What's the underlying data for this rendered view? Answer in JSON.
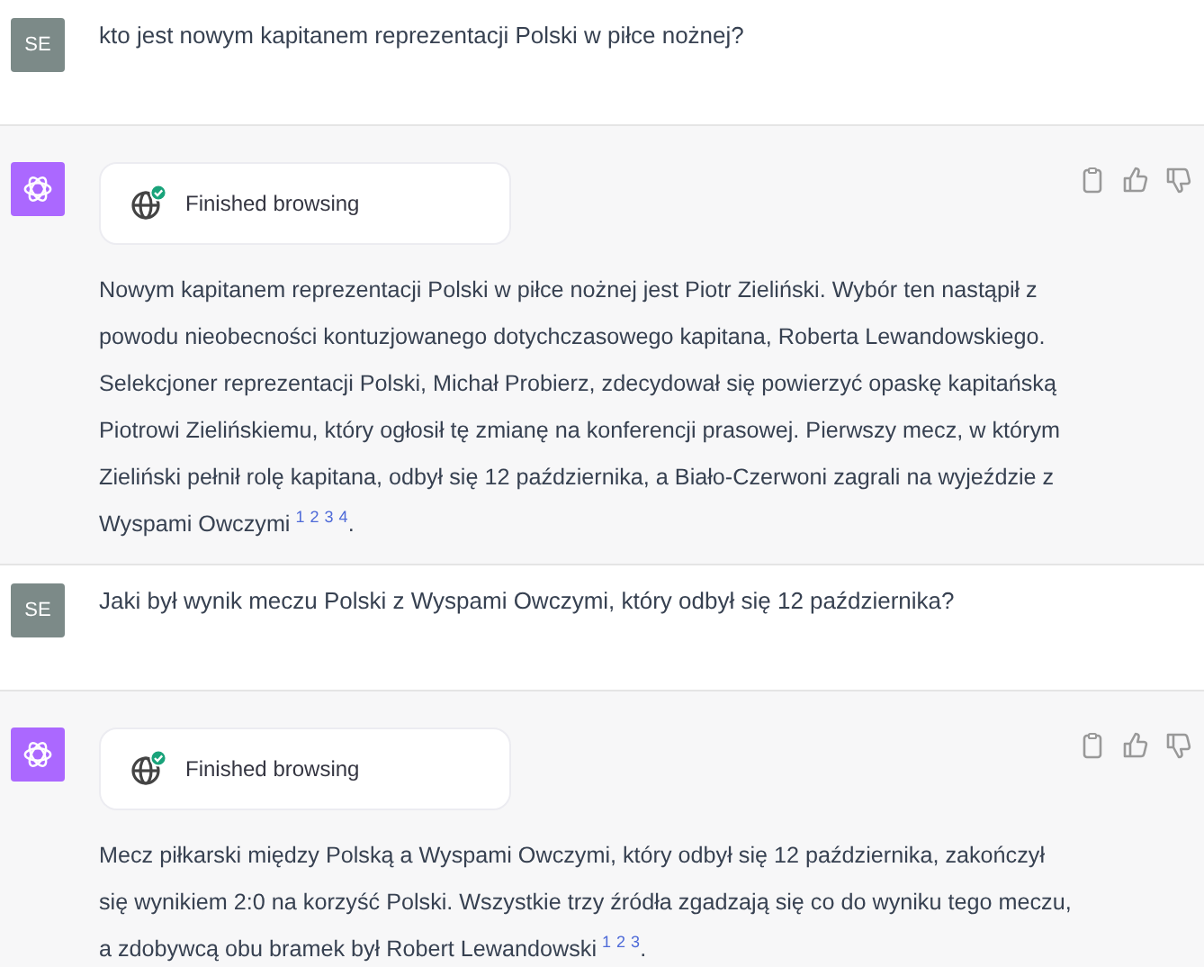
{
  "messages": [
    {
      "kind": "user",
      "avatar": "SE",
      "text": "kto jest nowym kapitanem reprezentacji Polski w piłce nożnej?"
    },
    {
      "kind": "assistant",
      "status": "Finished browsing",
      "text": "Nowym kapitanem reprezentacji Polski w piłce nożnej jest Piotr Zieliński. Wybór ten nastąpił z powodu nieobecności kontuzjowanego dotychczasowego kapitana, Roberta Lewandowskiego. Selekcjoner reprezentacji Polski, Michał Probierz, zdecydował się powierzyć opaskę kapitańską Piotrowi Zielińskiemu, który ogłosił tę zmianę na konferencji prasowej. Pierwszy mecz, w którym Zieliński pełnił rolę kapitana, odbył się 12 października, a Biało-Czerwoni zagrali na wyjeździe z Wyspami Owczymi",
      "citations": [
        "1",
        "2",
        "3",
        "4"
      ],
      "end": "."
    },
    {
      "kind": "user",
      "avatar": "SE",
      "text": "Jaki był wynik meczu Polski z Wyspami Owczymi, który odbył się 12 października?"
    },
    {
      "kind": "assistant",
      "status": "Finished browsing",
      "text": "Mecz piłkarski między Polską a Wyspami Owczymi, który odbył się 12 października, zakończył się wynikiem 2:0 na korzyść Polski. Wszystkie trzy źródła zgadzają się co do wyniku tego meczu, a zdobywcą obu bramek był Robert Lewandowski",
      "citations": [
        "1",
        "2",
        "3"
      ],
      "end": "."
    }
  ]
}
